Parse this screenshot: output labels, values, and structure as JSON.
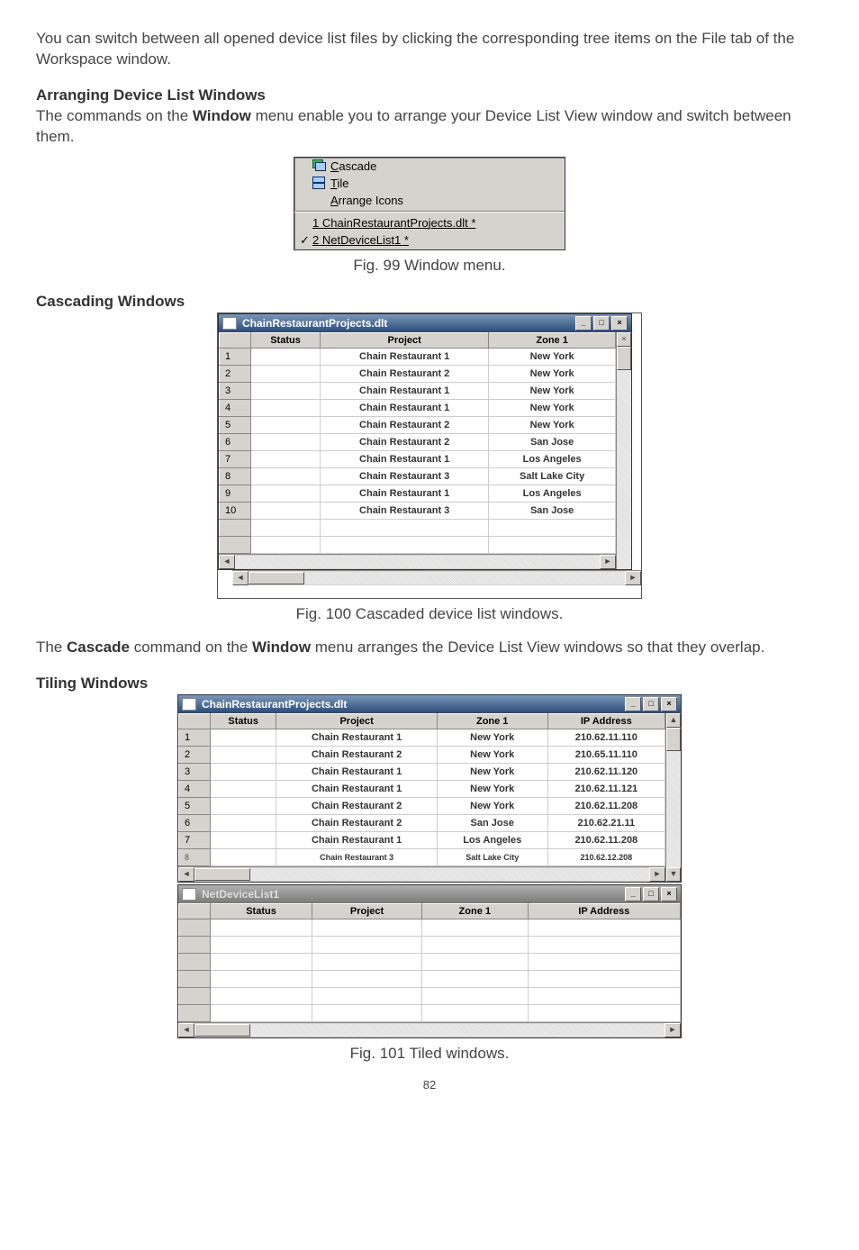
{
  "intro_para": "You can switch between all opened device list files by clicking the corresponding tree items on the File tab of the Workspace window.",
  "sec1_heading": "Arranging Device List Windows",
  "sec1_para_parts": {
    "a": "The commands on the ",
    "b": "Window",
    "c": " menu enable you to arrange your Device List View window and switch between them."
  },
  "menu": {
    "cascade": "Cascade",
    "tile": "Tile",
    "arrange": "Arrange Icons",
    "item1": "1 ChainRestaurantProjects.dlt *",
    "item2": "2 NetDeviceList1 *"
  },
  "fig99_caption": "Fig. 99 Window menu.",
  "sec2_heading": "Cascading Windows",
  "window1_title": "ChainRestaurantProjects.dlt",
  "columns": {
    "status": "Status",
    "project": "Project",
    "zone1": "Zone 1",
    "ip": "IP Address"
  },
  "cascade_rows": [
    {
      "n": "1",
      "project": "Chain Restaurant 1",
      "zone": "New York"
    },
    {
      "n": "2",
      "project": "Chain Restaurant 2",
      "zone": "New York"
    },
    {
      "n": "3",
      "project": "Chain Restaurant 1",
      "zone": "New York"
    },
    {
      "n": "4",
      "project": "Chain Restaurant 1",
      "zone": "New York"
    },
    {
      "n": "5",
      "project": "Chain Restaurant 2",
      "zone": "New York"
    },
    {
      "n": "6",
      "project": "Chain Restaurant 2",
      "zone": "San Jose"
    },
    {
      "n": "7",
      "project": "Chain Restaurant 1",
      "zone": "Los Angeles"
    },
    {
      "n": "8",
      "project": "Chain Restaurant 3",
      "zone": "Salt Lake City"
    },
    {
      "n": "9",
      "project": "Chain Restaurant 1",
      "zone": "Los Angeles"
    },
    {
      "n": "10",
      "project": "Chain Restaurant 3",
      "zone": "San Jose"
    }
  ],
  "fig100_caption": "Fig. 100 Cascaded device list windows.",
  "sec2_para_parts": {
    "a": "The ",
    "b": "Cascade",
    "c": " command on the ",
    "d": "Window",
    "e": " menu arranges the Device List View windows so that they overlap."
  },
  "sec3_heading": "Tiling Windows",
  "tile_rows": [
    {
      "n": "1",
      "project": "Chain Restaurant 1",
      "zone": "New York",
      "ip": "210.62.11.110"
    },
    {
      "n": "2",
      "project": "Chain Restaurant 2",
      "zone": "New York",
      "ip": "210.65.11.110"
    },
    {
      "n": "3",
      "project": "Chain Restaurant 1",
      "zone": "New York",
      "ip": "210.62.11.120"
    },
    {
      "n": "4",
      "project": "Chain Restaurant 1",
      "zone": "New York",
      "ip": "210.62.11.121"
    },
    {
      "n": "5",
      "project": "Chain Restaurant 2",
      "zone": "New York",
      "ip": "210.62.11.208"
    },
    {
      "n": "6",
      "project": "Chain Restaurant 2",
      "zone": "San Jose",
      "ip": "210.62.21.11"
    },
    {
      "n": "7",
      "project": "Chain Restaurant 1",
      "zone": "Los Angeles",
      "ip": "210.62.11.208"
    },
    {
      "n": "8",
      "project": "Chain Restaurant 3",
      "zone": "Salt Lake City",
      "ip": "210.62.12.208"
    }
  ],
  "window2_title": "NetDeviceList1",
  "fig101_caption": "Fig. 101 Tiled windows.",
  "page_number": "82"
}
